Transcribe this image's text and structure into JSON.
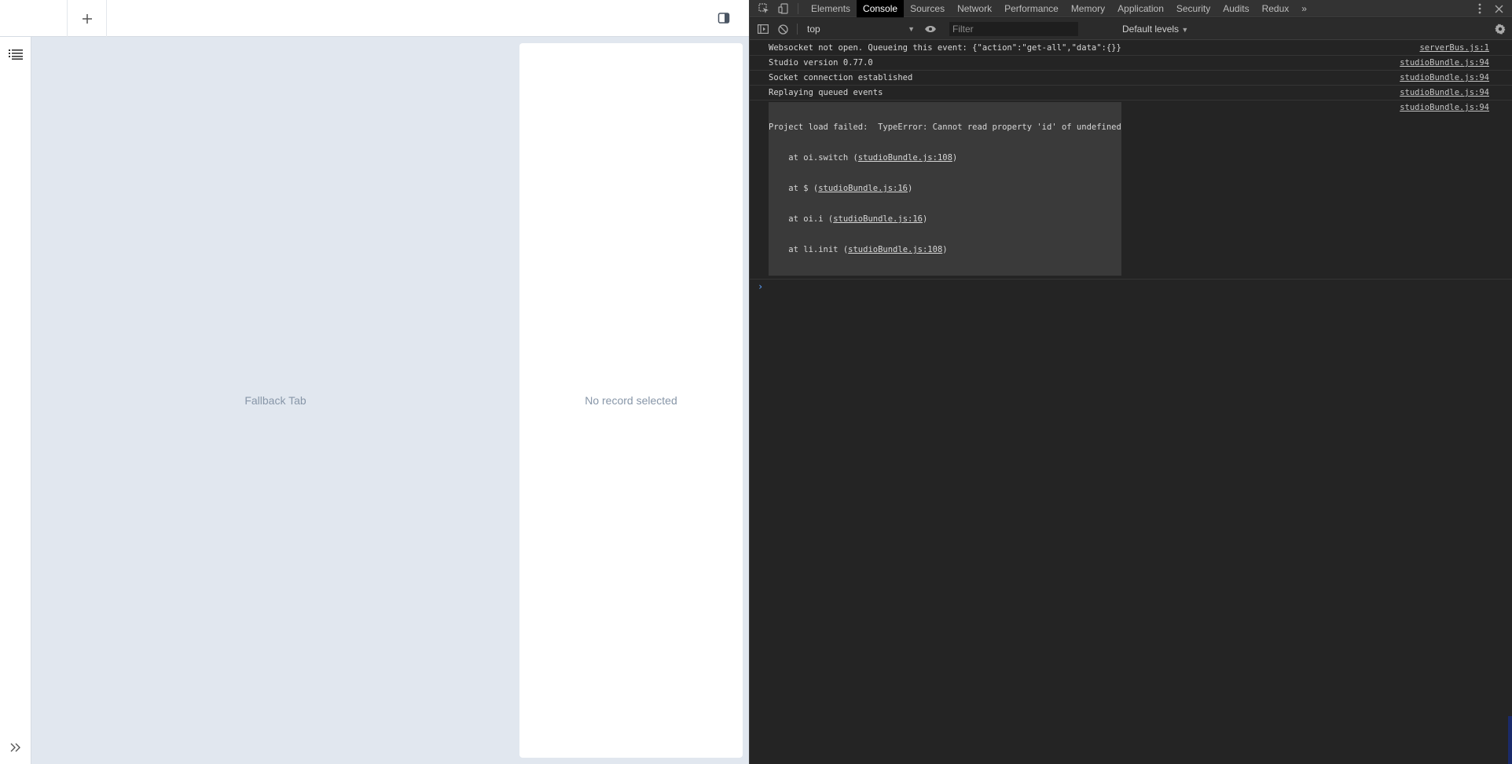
{
  "app": {
    "add_tab_symbol": "+",
    "main_placeholder": "Fallback Tab",
    "record_placeholder": "No record selected",
    "icons": {
      "add": "plus-icon",
      "panel_toggle": "panel-toggle-icon",
      "list": "list-icon",
      "expand": "double-chevron-right-icon"
    }
  },
  "devtools": {
    "tabs": [
      {
        "label": "Elements"
      },
      {
        "label": "Console",
        "active": true
      },
      {
        "label": "Sources"
      },
      {
        "label": "Network"
      },
      {
        "label": "Performance"
      },
      {
        "label": "Memory"
      },
      {
        "label": "Application"
      },
      {
        "label": "Security"
      },
      {
        "label": "Audits"
      },
      {
        "label": "Redux"
      }
    ],
    "more_tabs_symbol": "»",
    "toolbar": {
      "context": "top",
      "filter_placeholder": "Filter",
      "levels": "Default levels"
    },
    "console": {
      "messages": [
        {
          "text": "Websocket not open. Queueing this event: {\"action\":\"get-all\",\"data\":{}}",
          "source": "serverBus.js:1"
        },
        {
          "text": "Studio version 0.77.0",
          "source": "studioBundle.js:94"
        },
        {
          "text": "Socket connection established",
          "source": "studioBundle.js:94"
        },
        {
          "text": "Replaying queued events",
          "source": "studioBundle.js:94"
        }
      ],
      "error": {
        "text": "Project load failed:  TypeError: Cannot read property 'id' of undefined",
        "source": "studioBundle.js:94",
        "stack": [
          {
            "prefix": "    at oi.switch (",
            "link": "studioBundle.js:108",
            "suffix": ")"
          },
          {
            "prefix": "    at $ (",
            "link": "studioBundle.js:16",
            "suffix": ")"
          },
          {
            "prefix": "    at oi.i (",
            "link": "studioBundle.js:16",
            "suffix": ")"
          },
          {
            "prefix": "    at li.init (",
            "link": "studioBundle.js:108",
            "suffix": ")"
          }
        ]
      },
      "prompt_symbol": "›"
    },
    "colors": {
      "panel_bg": "#242424",
      "active_tab_bg": "#000000",
      "prompt_accent": "#5aa0ff"
    }
  }
}
